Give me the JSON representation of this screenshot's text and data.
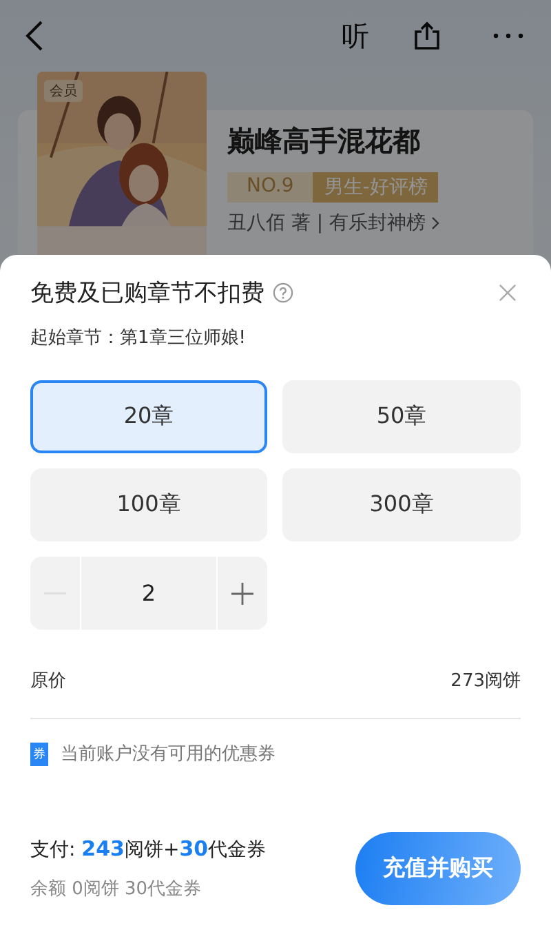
{
  "top_bar": {
    "listen_label": "听"
  },
  "book": {
    "cover": {
      "badge": "会员"
    },
    "title": "巅峰高手混花都",
    "rank": "NO.9",
    "rank_list": "男生-好评榜",
    "author_line": "丑八佰 著 | 有乐封神榜"
  },
  "sheet": {
    "title": "免费及已购章节不扣费",
    "start_chapter": "起始章节：第1章三位师娘!",
    "options": [
      {
        "label": "20章",
        "selected": true
      },
      {
        "label": "50章",
        "selected": false
      },
      {
        "label": "100章",
        "selected": false
      },
      {
        "label": "300章",
        "selected": false
      }
    ],
    "stepper": {
      "value": "2",
      "minus_disabled": true
    },
    "price_label": "原价",
    "price_value": "273阅饼",
    "coupon_icon": "券",
    "coupon_text": "当前账户没有可用的优惠券",
    "pay": [
      {
        "text": "支付: ",
        "highlight": false
      },
      {
        "text": "243",
        "highlight": true
      },
      {
        "text": "阅饼+",
        "highlight": false
      },
      {
        "text": "30",
        "highlight": true
      },
      {
        "text": "代金券",
        "highlight": false
      }
    ],
    "balance": "余额 0阅饼 30代金券",
    "buy_button": "充值并购买"
  }
}
